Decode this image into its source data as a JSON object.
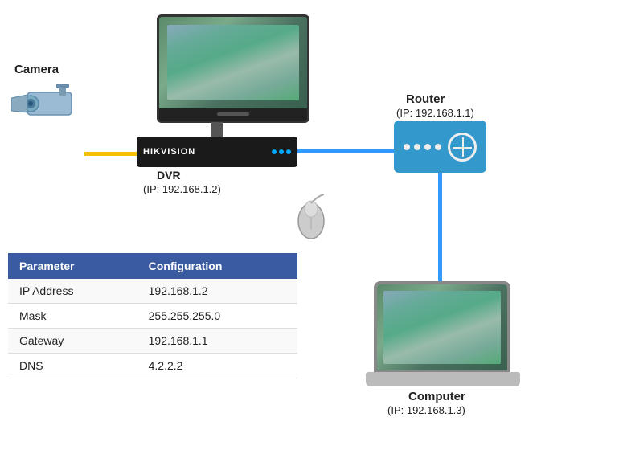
{
  "diagram": {
    "camera_label": "Camera",
    "dvr_label": "DVR",
    "dvr_ip": "(IP:  192.168.1.2)",
    "dvr_brand": "HIKVISION",
    "router_label": "Router",
    "router_ip": "(IP:  192.168.1.1)",
    "computer_label": "Computer",
    "computer_ip": "(IP:  192.168.1.3)"
  },
  "table": {
    "header": {
      "col1": "Parameter",
      "col2": "Configuration"
    },
    "rows": [
      {
        "param": "IP Address",
        "value": "192.168.1.2"
      },
      {
        "param": "Mask",
        "value": "255.255.255.0"
      },
      {
        "param": "Gateway",
        "value": "192.168.1.1"
      },
      {
        "param": "DNS",
        "value": "4.2.2.2"
      }
    ]
  }
}
